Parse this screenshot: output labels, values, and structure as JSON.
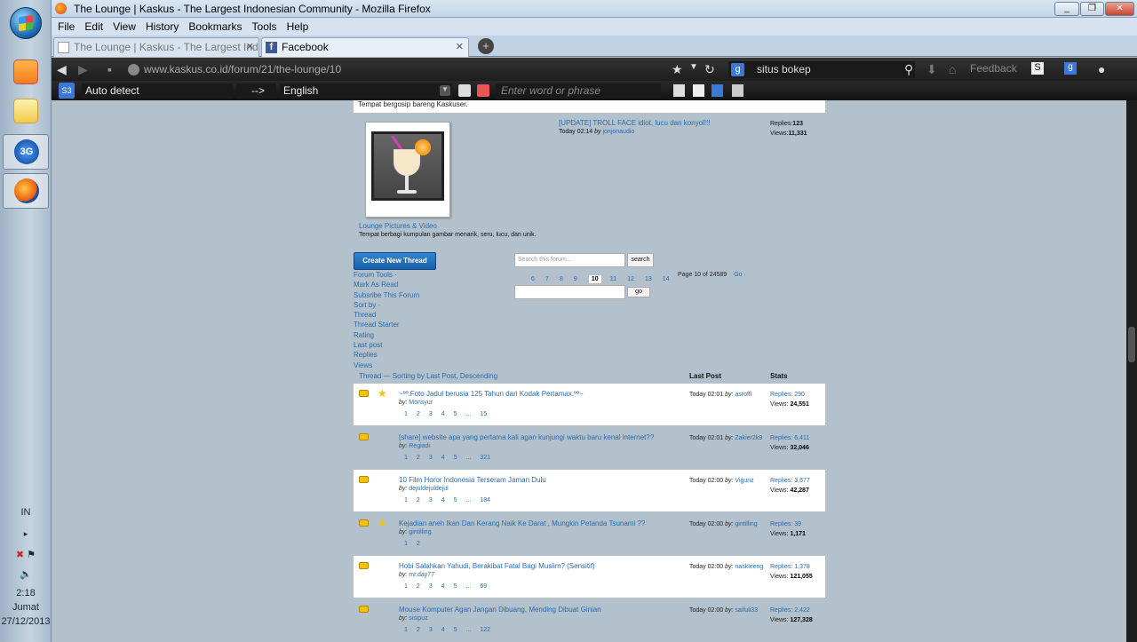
{
  "window": {
    "title": "The Lounge | Kaskus - The Largest Indonesian Community - Mozilla Firefox"
  },
  "menu": [
    "File",
    "Edit",
    "View",
    "History",
    "Bookmarks",
    "Tools",
    "Help"
  ],
  "tabs": [
    {
      "label": "The Lounge | Kaskus - The Largest Ind...",
      "active": false
    },
    {
      "label": "Facebook",
      "active": true
    }
  ],
  "nav": {
    "url": "www.kaskus.co.id/forum/21/the-lounge/10",
    "search": "situs bokep",
    "feedback": "Feedback"
  },
  "translate": {
    "from": "Auto detect",
    "arrow": "-->",
    "to": "English",
    "placeholder": "Enter word or phrase"
  },
  "taskbar": {
    "lang": "IN",
    "time": "2:18",
    "day": "Jumat",
    "date": "27/12/2013"
  },
  "page": {
    "desc_top": "Tempat bergosip bareng Kaskuser.",
    "featured": {
      "title": "[UPDATE] TROLL FACE idiot, lucu dan konyol!!!",
      "time": "Today 02:14",
      "by": "by",
      "user": "jonjonaudio",
      "replies_label": "Replies:",
      "replies": "123",
      "views_label": "Views:",
      "views": "11,331"
    },
    "subforum": {
      "name": "Lounge Pictures & Video",
      "desc": "Tempat berbagi kumpulan gambar menarik, seru, lucu, dan unik."
    },
    "create_button": "Create New Thread",
    "tools": [
      "Forum Tools ·",
      "Mark As Read",
      "Subsribe This Forum",
      "Sort by ·",
      "Thread",
      "Thread Starter",
      "Rating",
      "Last post",
      "Replies",
      "Views"
    ],
    "search_placeholder": "Search this forum...",
    "search_button": "search",
    "pager": [
      "6",
      "7",
      "8",
      "9",
      "10",
      "11",
      "12",
      "13",
      "14"
    ],
    "pager_current": "10",
    "page_info": "Page 10 of 24589",
    "go_label": "Go ·",
    "go_button": "go",
    "header_thread": "Thread — Sorting by Last Post, Descending",
    "header_last": "Last Post",
    "header_stats": "Stats",
    "threads": [
      {
        "title": "~ºº.Foto Jadul berusia 125 Tahun dari Kodak Pertamax.ºº~",
        "author": "Monsyur",
        "pages": [
          "1",
          "2",
          "3",
          "4",
          "5",
          "...",
          "15"
        ],
        "lp_time": "Today 02:01",
        "lp_user": "asroffi",
        "replies": "290",
        "views": "24,551",
        "star": true,
        "bg": "w"
      },
      {
        "title": "[share] website apa yang pertama kali agan kunjungi waktu baru kenal internet??",
        "author": "Regiadi",
        "pages": [
          "1",
          "2",
          "3",
          "4",
          "5",
          "...",
          "321"
        ],
        "lp_time": "Today 02:01",
        "lp_user": "Zakier2k9",
        "replies": "6,411",
        "views": "32,046",
        "star": false,
        "bg": "g"
      },
      {
        "title": "10 Film Horor Indonesia Terseram Jaman Dulu",
        "author": "dejuldejuldejul",
        "pages": [
          "1",
          "2",
          "3",
          "4",
          "5",
          "...",
          "184"
        ],
        "lp_time": "Today 02:00",
        "lp_user": "Vigunz",
        "replies": "3,677",
        "views": "42,287",
        "star": false,
        "bg": "w"
      },
      {
        "title": "Kejadian aneh Ikan Dan Kerang Naik Ke Darat , Mungkin Petanda Tsunami ??",
        "author": "gintilling",
        "pages": [
          "1",
          "2"
        ],
        "lp_time": "Today 02:00",
        "lp_user": "gintilling",
        "replies": "39",
        "views": "1,171",
        "star": true,
        "bg": "g"
      },
      {
        "title": "Hobi Salahkan Yahudi, Berakibat Fatal Bagi Muslim? (Sensitif)",
        "author": "mr.day77",
        "pages": [
          "1",
          "2",
          "3",
          "4",
          "5",
          "...",
          "69"
        ],
        "lp_time": "Today 02:00",
        "lp_user": "naskleeng",
        "replies": "1,378",
        "views": "121,055",
        "star": false,
        "bg": "w"
      },
      {
        "title": "Mouse Komputer Agan Jangan Dibuang, Mending Dibuat Ginian",
        "author": "sisipuz",
        "pages": [
          "1",
          "2",
          "3",
          "4",
          "5",
          "...",
          "122"
        ],
        "lp_time": "Today 02:00",
        "lp_user": "saifuli33",
        "replies": "2,422",
        "views": "127,328",
        "star": false,
        "bg": "g"
      }
    ]
  }
}
